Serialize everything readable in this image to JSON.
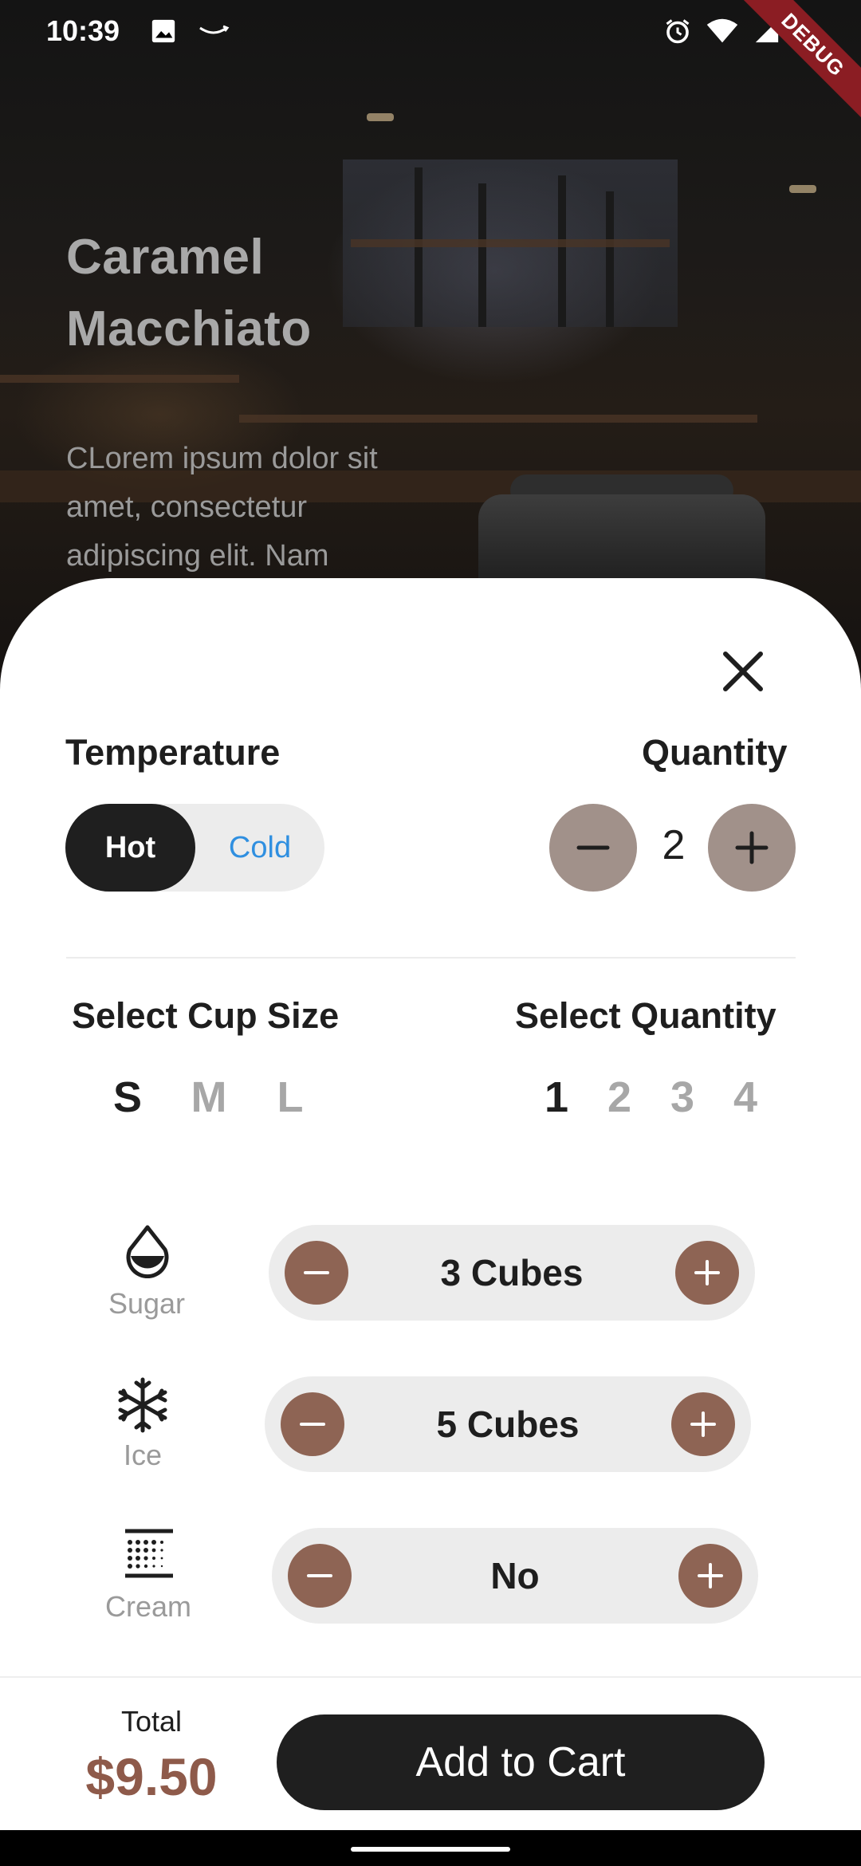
{
  "status_bar": {
    "time": "10:39",
    "debug_label": "DEBUG",
    "icons_left": [
      "image-icon",
      "amazon-smile-icon"
    ],
    "icons_right": [
      "alarm-icon",
      "wifi-icon",
      "signal-icon",
      "battery-icon"
    ]
  },
  "hero": {
    "title_line1": "Caramel",
    "title_line2": "Macchiato",
    "description_line1": "CLorem ipsum dolor sit",
    "description_line2": "amet, consectetur",
    "description_line3": "adipiscing elit. Nam"
  },
  "sheet": {
    "temperature": {
      "label": "Temperature",
      "options": [
        "Hot",
        "Cold"
      ],
      "selected": "Hot"
    },
    "quantity": {
      "label": "Quantity",
      "value": "2"
    },
    "cup_size": {
      "label": "Select Cup Size",
      "options": [
        "S",
        "M",
        "L"
      ],
      "selected": "S"
    },
    "select_quantity": {
      "label": "Select Quantity",
      "options": [
        "1",
        "2",
        "3",
        "4"
      ],
      "selected": "1"
    },
    "extras": [
      {
        "label": "Sugar",
        "icon": "drop-icon",
        "value": "3 Cubes"
      },
      {
        "label": "Ice",
        "icon": "snowflake-icon",
        "value": "5 Cubes"
      },
      {
        "label": "Cream",
        "icon": "cream-icon",
        "value": "No"
      }
    ]
  },
  "footer": {
    "total_label": "Total",
    "total_value": "$9.50",
    "cart_button": "Add to Cart"
  },
  "colors": {
    "accent_brown": "#8e6454",
    "stepper_gray_brown": "#a1918a",
    "price_brown": "#8e5a4a",
    "dark": "#1f1f1f",
    "cold_blue": "#2f8fe0"
  }
}
